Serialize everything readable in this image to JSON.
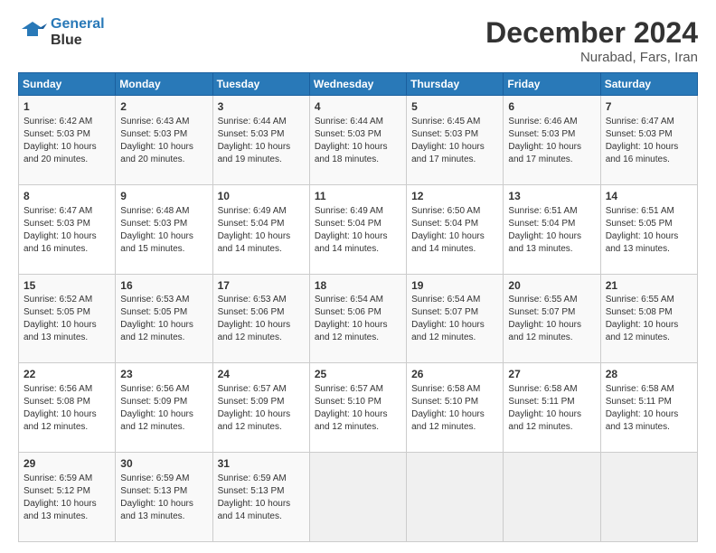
{
  "header": {
    "logo_line1": "General",
    "logo_line2": "Blue",
    "main_title": "December 2024",
    "sub_title": "Nurabad, Fars, Iran"
  },
  "weekdays": [
    "Sunday",
    "Monday",
    "Tuesday",
    "Wednesday",
    "Thursday",
    "Friday",
    "Saturday"
  ],
  "weeks": [
    [
      {
        "day": "1",
        "lines": [
          "Sunrise: 6:42 AM",
          "Sunset: 5:03 PM",
          "Daylight: 10 hours",
          "and 20 minutes."
        ]
      },
      {
        "day": "2",
        "lines": [
          "Sunrise: 6:43 AM",
          "Sunset: 5:03 PM",
          "Daylight: 10 hours",
          "and 20 minutes."
        ]
      },
      {
        "day": "3",
        "lines": [
          "Sunrise: 6:44 AM",
          "Sunset: 5:03 PM",
          "Daylight: 10 hours",
          "and 19 minutes."
        ]
      },
      {
        "day": "4",
        "lines": [
          "Sunrise: 6:44 AM",
          "Sunset: 5:03 PM",
          "Daylight: 10 hours",
          "and 18 minutes."
        ]
      },
      {
        "day": "5",
        "lines": [
          "Sunrise: 6:45 AM",
          "Sunset: 5:03 PM",
          "Daylight: 10 hours",
          "and 17 minutes."
        ]
      },
      {
        "day": "6",
        "lines": [
          "Sunrise: 6:46 AM",
          "Sunset: 5:03 PM",
          "Daylight: 10 hours",
          "and 17 minutes."
        ]
      },
      {
        "day": "7",
        "lines": [
          "Sunrise: 6:47 AM",
          "Sunset: 5:03 PM",
          "Daylight: 10 hours",
          "and 16 minutes."
        ]
      }
    ],
    [
      {
        "day": "8",
        "lines": [
          "Sunrise: 6:47 AM",
          "Sunset: 5:03 PM",
          "Daylight: 10 hours",
          "and 16 minutes."
        ]
      },
      {
        "day": "9",
        "lines": [
          "Sunrise: 6:48 AM",
          "Sunset: 5:03 PM",
          "Daylight: 10 hours",
          "and 15 minutes."
        ]
      },
      {
        "day": "10",
        "lines": [
          "Sunrise: 6:49 AM",
          "Sunset: 5:04 PM",
          "Daylight: 10 hours",
          "and 14 minutes."
        ]
      },
      {
        "day": "11",
        "lines": [
          "Sunrise: 6:49 AM",
          "Sunset: 5:04 PM",
          "Daylight: 10 hours",
          "and 14 minutes."
        ]
      },
      {
        "day": "12",
        "lines": [
          "Sunrise: 6:50 AM",
          "Sunset: 5:04 PM",
          "Daylight: 10 hours",
          "and 14 minutes."
        ]
      },
      {
        "day": "13",
        "lines": [
          "Sunrise: 6:51 AM",
          "Sunset: 5:04 PM",
          "Daylight: 10 hours",
          "and 13 minutes."
        ]
      },
      {
        "day": "14",
        "lines": [
          "Sunrise: 6:51 AM",
          "Sunset: 5:05 PM",
          "Daylight: 10 hours",
          "and 13 minutes."
        ]
      }
    ],
    [
      {
        "day": "15",
        "lines": [
          "Sunrise: 6:52 AM",
          "Sunset: 5:05 PM",
          "Daylight: 10 hours",
          "and 13 minutes."
        ]
      },
      {
        "day": "16",
        "lines": [
          "Sunrise: 6:53 AM",
          "Sunset: 5:05 PM",
          "Daylight: 10 hours",
          "and 12 minutes."
        ]
      },
      {
        "day": "17",
        "lines": [
          "Sunrise: 6:53 AM",
          "Sunset: 5:06 PM",
          "Daylight: 10 hours",
          "and 12 minutes."
        ]
      },
      {
        "day": "18",
        "lines": [
          "Sunrise: 6:54 AM",
          "Sunset: 5:06 PM",
          "Daylight: 10 hours",
          "and 12 minutes."
        ]
      },
      {
        "day": "19",
        "lines": [
          "Sunrise: 6:54 AM",
          "Sunset: 5:07 PM",
          "Daylight: 10 hours",
          "and 12 minutes."
        ]
      },
      {
        "day": "20",
        "lines": [
          "Sunrise: 6:55 AM",
          "Sunset: 5:07 PM",
          "Daylight: 10 hours",
          "and 12 minutes."
        ]
      },
      {
        "day": "21",
        "lines": [
          "Sunrise: 6:55 AM",
          "Sunset: 5:08 PM",
          "Daylight: 10 hours",
          "and 12 minutes."
        ]
      }
    ],
    [
      {
        "day": "22",
        "lines": [
          "Sunrise: 6:56 AM",
          "Sunset: 5:08 PM",
          "Daylight: 10 hours",
          "and 12 minutes."
        ]
      },
      {
        "day": "23",
        "lines": [
          "Sunrise: 6:56 AM",
          "Sunset: 5:09 PM",
          "Daylight: 10 hours",
          "and 12 minutes."
        ]
      },
      {
        "day": "24",
        "lines": [
          "Sunrise: 6:57 AM",
          "Sunset: 5:09 PM",
          "Daylight: 10 hours",
          "and 12 minutes."
        ]
      },
      {
        "day": "25",
        "lines": [
          "Sunrise: 6:57 AM",
          "Sunset: 5:10 PM",
          "Daylight: 10 hours",
          "and 12 minutes."
        ]
      },
      {
        "day": "26",
        "lines": [
          "Sunrise: 6:58 AM",
          "Sunset: 5:10 PM",
          "Daylight: 10 hours",
          "and 12 minutes."
        ]
      },
      {
        "day": "27",
        "lines": [
          "Sunrise: 6:58 AM",
          "Sunset: 5:11 PM",
          "Daylight: 10 hours",
          "and 12 minutes."
        ]
      },
      {
        "day": "28",
        "lines": [
          "Sunrise: 6:58 AM",
          "Sunset: 5:11 PM",
          "Daylight: 10 hours",
          "and 13 minutes."
        ]
      }
    ],
    [
      {
        "day": "29",
        "lines": [
          "Sunrise: 6:59 AM",
          "Sunset: 5:12 PM",
          "Daylight: 10 hours",
          "and 13 minutes."
        ]
      },
      {
        "day": "30",
        "lines": [
          "Sunrise: 6:59 AM",
          "Sunset: 5:13 PM",
          "Daylight: 10 hours",
          "and 13 minutes."
        ]
      },
      {
        "day": "31",
        "lines": [
          "Sunrise: 6:59 AM",
          "Sunset: 5:13 PM",
          "Daylight: 10 hours",
          "and 14 minutes."
        ]
      },
      {
        "day": "",
        "lines": []
      },
      {
        "day": "",
        "lines": []
      },
      {
        "day": "",
        "lines": []
      },
      {
        "day": "",
        "lines": []
      }
    ]
  ]
}
